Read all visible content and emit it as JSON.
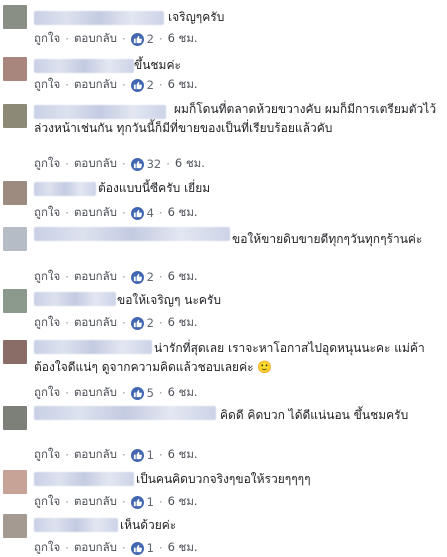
{
  "actions": {
    "like": "ถูกใจ",
    "reply": "ตอบกลับ",
    "sep": "·"
  },
  "colors": {
    "like_blue": "#4267b2",
    "meta_gray": "#616770"
  },
  "comments": [
    {
      "text": "เจริญๆครับ",
      "likes": "2",
      "time": "6 ชม.",
      "avatar_color": "#8a8f86"
    },
    {
      "text": "ขึ้นชมค่ะ",
      "likes": "2",
      "time": "6 ชม.",
      "avatar_color": "#a8867e"
    },
    {
      "text": "ผมก็โดนที่ตลาดห้วยขวางคับ ผมก็มีการเตรียมตัวไว้ล่วงหน้าเช่นกัน ทุกวันนี้ก็มีที่ขายของเป็นที่เรียบร้อยแล้วคับ",
      "likes": "32",
      "time": "6 ชม.",
      "avatar_color": "#8c8a77"
    },
    {
      "text": "ต้องแบบนี้ซีครับ เยี่ยม",
      "likes": "4",
      "time": "6 ชม.",
      "avatar_color": "#9d8b80"
    },
    {
      "text": "ขอให้ขายดิบขายดีทุกๆวันทุกๆร้านค่ะ",
      "likes": "2",
      "time": "6 ชม.",
      "avatar_color": "#b6bcc5"
    },
    {
      "text": "ขอให้เจริญๆ นะครับ",
      "likes": "2",
      "time": "6 ชม.",
      "avatar_color": "#8c9a8e"
    },
    {
      "text": "น่ารักที่สุดเลย เราจะหาโอกาสไปอุดหนุนนะคะ แม่ค้าต้องใจดีแน่ๆ ดูจากความคิดแล้วชอบเลยค่ะ 🙂",
      "likes": "5",
      "time": "6 ชม.",
      "avatar_color": "#8a6d66"
    },
    {
      "text": "คิดดี คิดบวก ได้ดีแน่นอน ขึ้นชมครับ",
      "likes": "1",
      "time": "6 ชม.",
      "avatar_color": "#7c8078"
    },
    {
      "text": "เป็นคนคิดบวกจริงๆขอให้รวยๆๆๆๆ",
      "likes": "1",
      "time": "6 ชม.",
      "avatar_color": "#c7a297"
    },
    {
      "text": "เห็นด้วยค่ะ",
      "likes": "1",
      "time": "6 ชม.",
      "avatar_color": "#a59a92"
    }
  ]
}
